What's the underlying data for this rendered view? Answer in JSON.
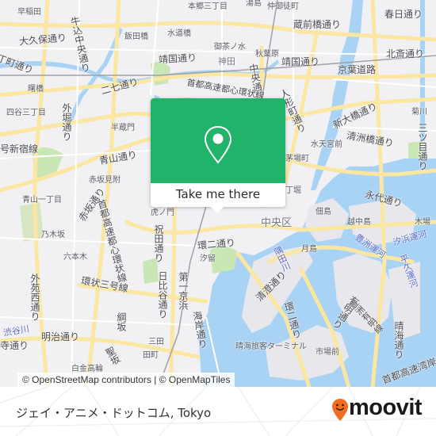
{
  "map": {
    "colors": {
      "land": "#f1f0f3",
      "water": "#a9d3f5",
      "road_major": "#fbe6a2",
      "road_minor": "#ffffff",
      "park": "#c9e7b5",
      "rail": "#a0a0a8",
      "accent": "#1fb46a"
    },
    "labels": {
      "waseda": "早稲田",
      "okubo_dori": "大久保通り",
      "ushigome_chuo_dori": "牛込中央通り",
      "iidabashi": "飯田橋",
      "hongo_sanchome": "本郷三丁目",
      "yushima": "湯島",
      "naka_okachimachi": "仲御徒町",
      "kuramaebashi_dori": "蔵前橋通り",
      "kasuga_dori": "春日通り",
      "suidobashi": "水道橋",
      "ochanomizu": "御茶ノ水",
      "akihabara": "秋葉原",
      "kanda": "神田",
      "yasukuni_dori_w": "靖国通り",
      "yasukuni_dori_e": "靖国通り",
      "keiyo_doro": "京葉道路",
      "hokusai_dori": "北斎通り",
      "chuo_dori": "中央通り",
      "shuto_expressway": "首都高速都心環状線",
      "ningyocho_dori": "人形町通り",
      "shin_ohashi_dori": "新大橋通り",
      "kikukawa": "菊川",
      "nanae_dori": "二七通り",
      "sotobori_dori": "外堀通り",
      "yotsuya_sanchome": "四谷三丁目",
      "akebonobashi": "曙橋",
      "cho_dori": "丁町通り",
      "hanzomon": "半蔵門",
      "shinjuku_line": "号新宿線",
      "aoyama_dori": "青山通り",
      "akasaka_mitsuke": "赤坂見附",
      "akasaka_dori": "赤坂通り",
      "aoyama_itchome": "青山一丁目",
      "nogizaka": "乃木坂",
      "shuto_loop": "首都高速都心環状線",
      "toranomon": "虎ノ門",
      "iwaida_dori": "祝田通り",
      "roppongi": "六本木",
      "gaien_nishi_dori": "外苑西通り",
      "kanjo_sango": "環状三号線",
      "shibuya_gawa": "渋谷川",
      "meiji_dori": "明治通り",
      "dori_w": "寺通り",
      "tsunazaka": "綱坂",
      "hijiri_zaka": "聖坂",
      "shirokane_takanawa": "白金高輪",
      "mita": "三田",
      "tamachi": "田町",
      "hibiya_dori": "日比谷通り",
      "daiichi_keihin": "第一京浜",
      "kaigan_dori": "海岸通り",
      "kan_ni_dori": "環二通り",
      "shiodome": "汐留",
      "chuo_ku": "中央区",
      "harumi_terminal": "晴海旅客ターミナル",
      "kiyosumi_dori": "清澄通り",
      "kan_ni_dori_e": "環二通り",
      "tsukishima": "月島",
      "sumida_gawa": "隅田川",
      "tsukuda": "佃島",
      "etchujima": "越中島",
      "toyosu_unga": "豊洲運河",
      "shiohama_unga": "汐浜運河",
      "kiba": "木場",
      "eitai_dori": "永代通り",
      "mitsume_dori": "三ツ目通り",
      "kiyosubashi_dori": "清洲橋通り",
      "suitengumae": "水天宮前",
      "kayabacho": "茅場町",
      "hatchobori": "丁堀",
      "ariake_dori": "有明通り",
      "harumi_dori": "晴海通り",
      "heikyu_unga": "平久運河",
      "shijomae": "市場前",
      "bayshore": "首都高速湾岸線",
      "toyosu_line": "豊洲有明線"
    },
    "attribution": "© OpenStreetMap contributors | © OpenMapTiles"
  },
  "popup": {
    "pin_icon": "map-pin-icon",
    "action_label": "Take me there"
  },
  "footer": {
    "place_name": "ジェイ・アニメ・ドットコム, Tokyo",
    "brand": "moovit",
    "brand_color": "#f26d21"
  }
}
